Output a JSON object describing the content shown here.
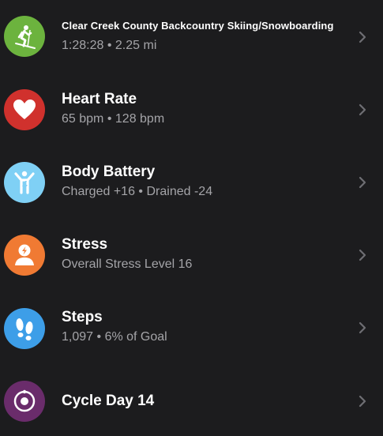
{
  "colors": {
    "background": "#1c1c1e",
    "activity_green": "#6cb33e",
    "heart_red": "#d0312d",
    "body_battery_blue": "#7fd0f5",
    "stress_orange": "#f07a33",
    "steps_blue": "#3d9ee8",
    "cycle_purple": "#6a2c6b",
    "subtitle_gray": "#a4a4a8",
    "chevron_gray": "#6e6e73"
  },
  "items": [
    {
      "icon": "skier-icon",
      "title": "Clear Creek County Backcountry Skiing/Snowboarding",
      "subtitle_a": "1:28:28",
      "subtitle_b": "2.25 mi"
    },
    {
      "icon": "heart-icon",
      "title": "Heart Rate",
      "subtitle_a": "65 bpm",
      "subtitle_b": "128 bpm"
    },
    {
      "icon": "body-battery-icon",
      "title": "Body Battery",
      "subtitle_a": "Charged +16",
      "subtitle_b": "Drained -24"
    },
    {
      "icon": "stress-icon",
      "title": "Stress",
      "subtitle_a": "Overall Stress Level 16"
    },
    {
      "icon": "footprints-icon",
      "title": "Steps",
      "subtitle_a": "1,097",
      "subtitle_b": "6% of Goal"
    },
    {
      "icon": "cycle-icon",
      "title": "Cycle Day 14"
    }
  ],
  "separator": "•"
}
